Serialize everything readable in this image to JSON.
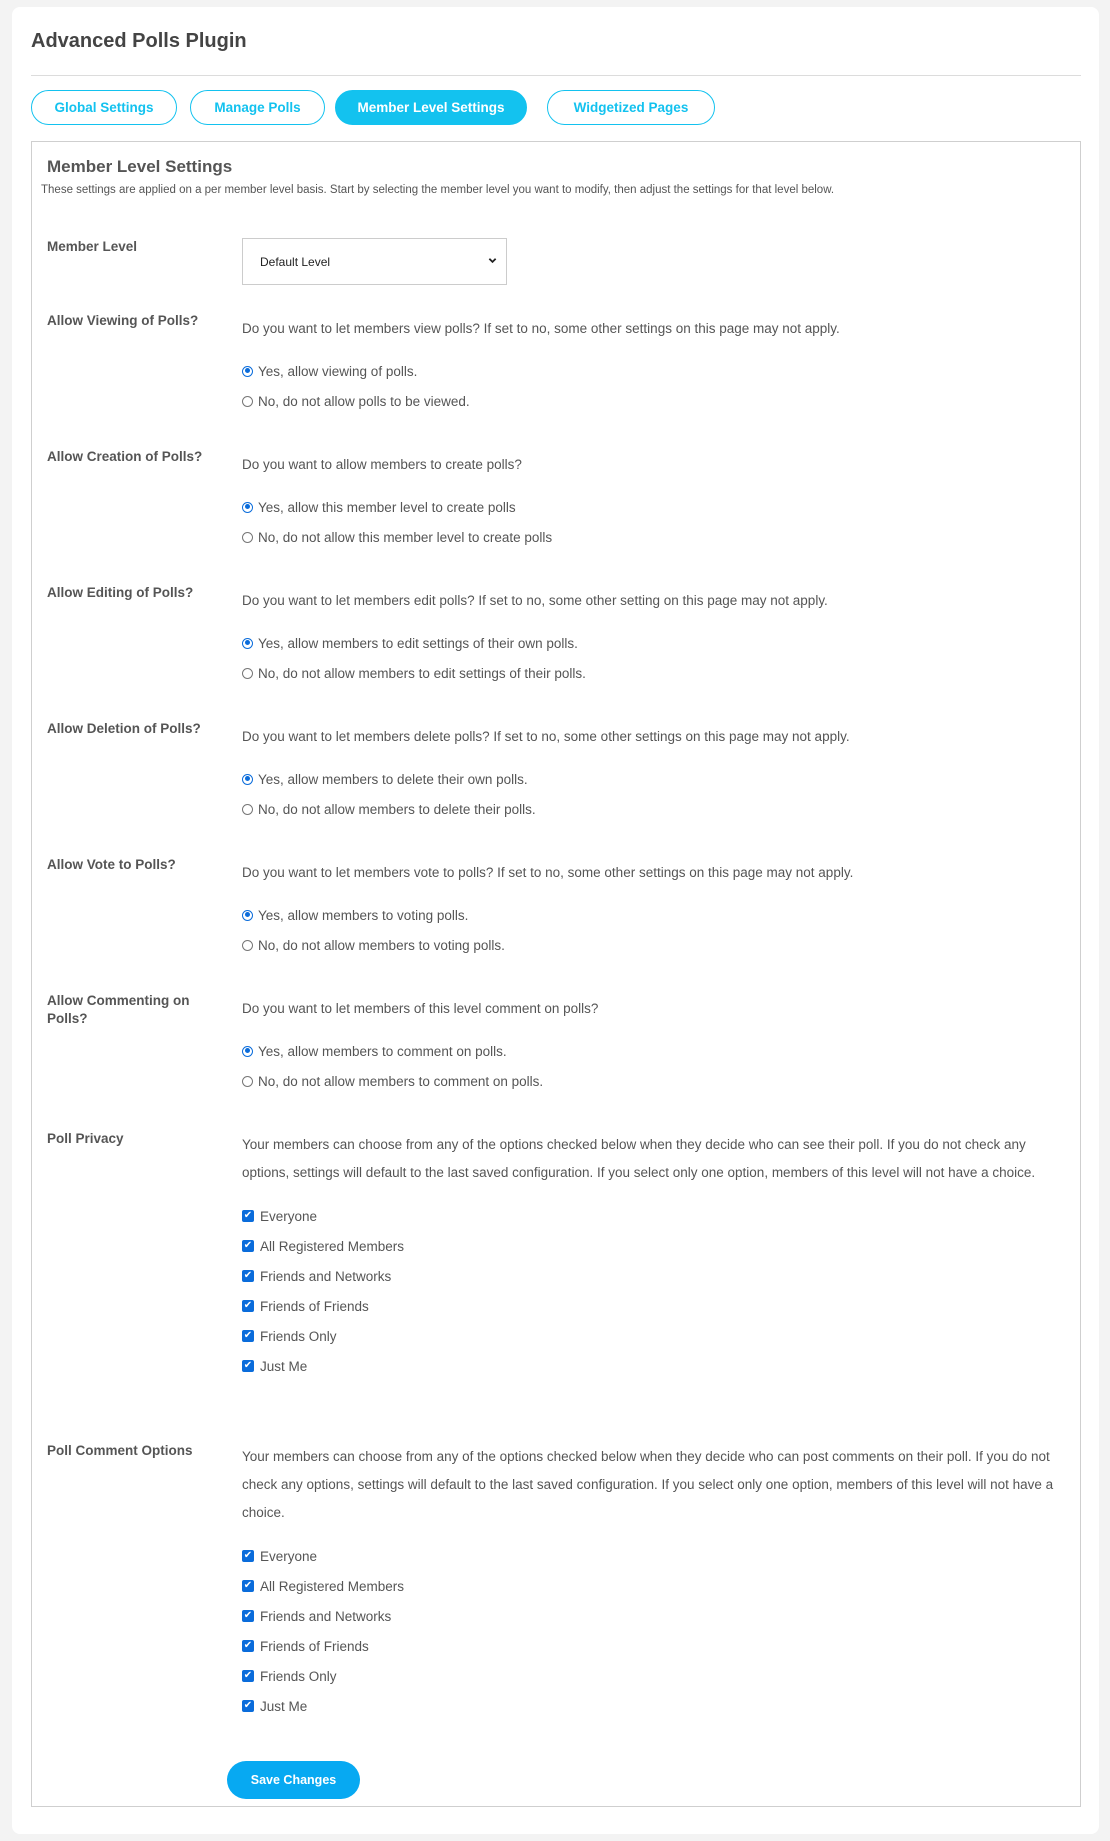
{
  "app": {
    "title": "Advanced Polls Plugin"
  },
  "tabs": [
    {
      "label": "Global Settings",
      "active": false
    },
    {
      "label": "Manage Polls",
      "active": false
    },
    {
      "label": "Member Level Settings",
      "active": true
    },
    {
      "label": "Widgetized Pages",
      "active": false
    }
  ],
  "colors": {
    "accent": "#13c2ef",
    "save_button": "#07a9f2",
    "control_blue": "#0a6cdb",
    "text": "#555555"
  },
  "panel": {
    "heading": "Member Level Settings",
    "description": "These settings are applied on a per member level basis. Start by selecting the member level you want to modify, then adjust the settings for that level below."
  },
  "member_level": {
    "label": "Member Level",
    "selected": "Default Level",
    "icon": "chevron-down-icon"
  },
  "radio_settings": [
    {
      "label": "Allow Viewing of Polls?",
      "description": "Do you want to let members view polls? If set to no, some other settings on this page may not apply.",
      "options": [
        {
          "label": "Yes, allow viewing of polls.",
          "selected": true
        },
        {
          "label": "No, do not allow polls to be viewed.",
          "selected": false
        }
      ]
    },
    {
      "label": "Allow Creation of Polls?",
      "description": "Do you want to allow members to create polls?",
      "options": [
        {
          "label": "Yes, allow this member level to create polls",
          "selected": true
        },
        {
          "label": "No, do not allow this member level to create polls",
          "selected": false
        }
      ]
    },
    {
      "label": "Allow Editing of Polls?",
      "description": "Do you want to let members edit polls? If set to no, some other setting on this page may not apply.",
      "options": [
        {
          "label": "Yes, allow members to edit settings of their own polls.",
          "selected": true
        },
        {
          "label": "No, do not allow members to edit settings of their polls.",
          "selected": false
        }
      ]
    },
    {
      "label": "Allow Deletion of Polls?",
      "description": "Do you want to let members delete polls? If set to no, some other settings on this page may not apply.",
      "options": [
        {
          "label": "Yes, allow members to delete their own polls.",
          "selected": true
        },
        {
          "label": "No, do not allow members to delete their polls.",
          "selected": false
        }
      ]
    },
    {
      "label": "Allow Vote to Polls?",
      "description": "Do you want to let members vote to polls? If set to no, some other settings on this page may not apply.",
      "options": [
        {
          "label": "Yes, allow members to voting polls.",
          "selected": true
        },
        {
          "label": "No, do not allow members to voting polls.",
          "selected": false
        }
      ]
    },
    {
      "label": "Allow Commenting on Polls?",
      "description": "Do you want to let members of this level comment on polls?",
      "options": [
        {
          "label": "Yes, allow members to comment on polls.",
          "selected": true
        },
        {
          "label": "No, do not allow members to comment on polls.",
          "selected": false
        }
      ]
    }
  ],
  "checkbox_settings": [
    {
      "label": "Poll Privacy",
      "description": "Your members can choose from any of the options checked below when they decide who can see their poll. If you do not check any options, settings will default to the last saved configuration. If you select only one option, members of this level will not have a choice.",
      "options": [
        {
          "label": "Everyone",
          "checked": true
        },
        {
          "label": "All Registered Members",
          "checked": true
        },
        {
          "label": "Friends and Networks",
          "checked": true
        },
        {
          "label": "Friends of Friends",
          "checked": true
        },
        {
          "label": "Friends Only",
          "checked": true
        },
        {
          "label": "Just Me",
          "checked": true
        }
      ]
    },
    {
      "label": "Poll Comment Options",
      "description": "Your members can choose from any of the options checked below when they decide who can post comments on their poll. If you do not check any options, settings will default to the last saved configuration. If you select only one option, members of this level will not have a choice.",
      "options": [
        {
          "label": "Everyone",
          "checked": true
        },
        {
          "label": "All Registered Members",
          "checked": true
        },
        {
          "label": "Friends and Networks",
          "checked": true
        },
        {
          "label": "Friends of Friends",
          "checked": true
        },
        {
          "label": "Friends Only",
          "checked": true
        },
        {
          "label": "Just Me",
          "checked": true
        }
      ]
    }
  ],
  "actions": {
    "save_label": "Save Changes"
  }
}
